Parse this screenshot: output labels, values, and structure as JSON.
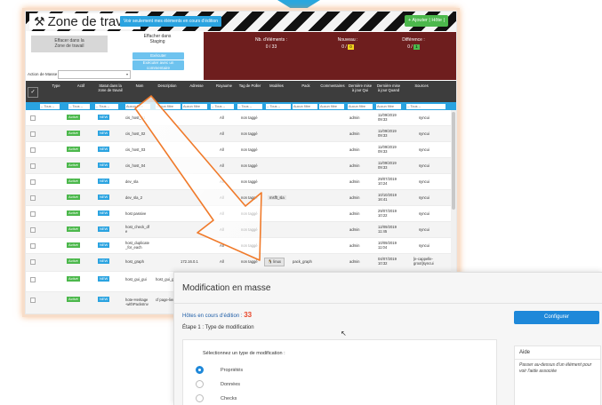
{
  "zone": {
    "title": "Zone de travail",
    "edit_only_btn": "Voir seulement mes éléments en cours d'édition",
    "add_btn": "+ Ajouter | Hôte |",
    "tab_remove": "Effacer dans la\nZone de travail",
    "tab_staging": "Effacher dans\nStaging",
    "btn_execute": "Exécuter",
    "btn_execute_sel": "Exécuter avec un\ncommentaire",
    "action_label": "Action de Masse",
    "stats": [
      {
        "label": "Nb. d'éléments :",
        "value": "0 / 33"
      },
      {
        "label": "Nouveau :",
        "value": "0 /",
        "badge": "0",
        "badge_color": "#f3d21f"
      },
      {
        "label": "Différence :",
        "value": "0 /",
        "badge": "1",
        "badge_color": "#4cb84c"
      }
    ]
  },
  "table": {
    "headers": [
      "Type",
      "Actif",
      "Statut dans la zone de travail",
      "Nom",
      "Description",
      "Adresse",
      "Royaume",
      "Tag de Poller",
      "Modèles",
      "Pack",
      "Commentaires",
      "Dernière mise à jour Qui",
      "Dernière mise à jour Quand",
      "Sources"
    ],
    "filters": [
      "-- Tous --",
      "-- Tous --",
      "-- Tous --",
      "Aucun filtre",
      "Aucun filtre",
      "Aucun filtre",
      "-- Tous --",
      "-- Tous --",
      "-- Tous --",
      "Aucun filtre",
      "Aucun filtre",
      "Aucun filtre",
      "Aucun filtre",
      "-- Tous --"
    ],
    "rows": [
      {
        "actif": "Activé",
        "statut": "NEW",
        "name": "cis_host_01",
        "desc": "",
        "addr": "",
        "realm": "All",
        "poller": "non taggé",
        "models": "",
        "pack": "",
        "who": "admin",
        "when": "11/09/2019\n09:33",
        "source": "syncui"
      },
      {
        "actif": "Activé",
        "statut": "NEW",
        "name": "cis_host_02",
        "desc": "",
        "addr": "",
        "realm": "All",
        "poller": "non taggé",
        "models": "",
        "pack": "",
        "who": "admin",
        "when": "11/09/2019\n09:33",
        "source": "syncui"
      },
      {
        "actif": "Activé",
        "statut": "NEW",
        "name": "cis_host_03",
        "desc": "",
        "addr": "",
        "realm": "All",
        "poller": "non taggé",
        "models": "",
        "pack": "",
        "who": "admin",
        "when": "11/09/2019\n09:33",
        "source": "syncui"
      },
      {
        "actif": "Activé",
        "statut": "NEW",
        "name": "cis_host_04",
        "desc": "",
        "addr": "",
        "realm": "All",
        "poller": "non taggé",
        "models": "",
        "pack": "",
        "who": "admin",
        "when": "11/09/2019\n09:33",
        "source": "syncui"
      },
      {
        "actif": "Activé",
        "statut": "NEW",
        "name": "dev_sla",
        "desc": "",
        "addr": "",
        "realm": "All",
        "poller": "non taggé",
        "models": "",
        "pack": "",
        "who": "admin",
        "when": "29/07/2019\n10:24",
        "source": "syncui"
      },
      {
        "actif": "Activé",
        "statut": "NEW",
        "name": "dev_sla_2",
        "desc": "",
        "addr": "",
        "realm": "All",
        "poller": "non taggé",
        "models": "msfft_sla",
        "pack": "",
        "who": "admin",
        "when": "10/10/2019\n16:41",
        "source": "syncui"
      },
      {
        "actif": "Activé",
        "statut": "NEW",
        "name": "host passive",
        "desc": "",
        "addr": "",
        "realm": "All",
        "poller": "non taggé",
        "models": "",
        "pack": "",
        "who": "admin",
        "when": "29/07/2019\n10:22",
        "source": "syncui"
      },
      {
        "actif": "Activé",
        "statut": "NEW",
        "name": "host_check_df\ne",
        "desc": "",
        "addr": "",
        "realm": "All",
        "poller": "non taggé",
        "models": "",
        "pack": "",
        "who": "admin",
        "when": "12/09/2019\n11:45",
        "source": "syncui"
      },
      {
        "actif": "Activé",
        "statut": "NEW",
        "name": "host_duplicate\n_for_each",
        "desc": "",
        "addr": "",
        "realm": "All",
        "poller": "non taggé",
        "models": "",
        "pack": "",
        "who": "admin",
        "when": "10/09/2019\n11:04",
        "source": "syncui"
      },
      {
        "actif": "Activé",
        "statut": "NEW",
        "name": "host_graph",
        "desc": "",
        "addr": "172.16.0.1",
        "realm": "All",
        "poller": "non taggé",
        "models": "linux",
        "pack": "pack_graph",
        "who": "admin",
        "when": "04/07/2019\n10:32",
        "source": "[e-cappelle-\ngroot]syncui"
      },
      {
        "actif": "Activé",
        "statut": "NEW",
        "name": "host_gui_gui",
        "desc": "host_gui_gui",
        "addr": "",
        "realm": "",
        "poller": "",
        "models": "",
        "pack": "",
        "who": "",
        "when": "",
        "source": ""
      },
      {
        "actif": "Activé",
        "statut": "NEW",
        "name": "hote-Heritage\n-withPacksInv",
        "desc": "cf page-lien-",
        "addr": "",
        "realm": "",
        "poller": "",
        "models": "",
        "pack": "",
        "who": "",
        "when": "",
        "source": ""
      }
    ]
  },
  "modal": {
    "title": "Modification en masse",
    "hosts_label": "Hôtes en cours d'édition :",
    "hosts_count": "33",
    "configure_btn": "Configurer",
    "step_title": "Étape 1 : Type de modification",
    "select_label": "Sélectionnez un type de modification :",
    "options": [
      "Propriétés",
      "Données",
      "Checks"
    ],
    "help_title": "Aide",
    "help_text": "Passer au-dessus d'un élément pour voir l'aide associée"
  },
  "colors": {
    "accent": "#2aa3e0",
    "success": "#4cb84c",
    "panel": "#6e1e1e",
    "arrow": "#f07a2a",
    "count": "#e8472b",
    "configure": "#1e88d9"
  },
  "icons": {
    "zone": "wrench-tools-icon",
    "arrow": "big-orange-arrow-icon",
    "cursor": "mouse-cursor-icon"
  }
}
